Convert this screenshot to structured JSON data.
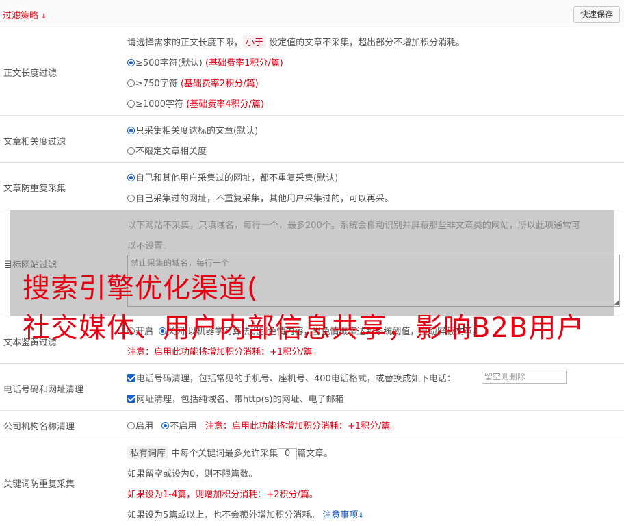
{
  "header": {
    "title": "过滤策略",
    "chevron_icon": "chevron-double-down-icon",
    "save_label": "快速保存"
  },
  "length_filter": {
    "label": "正文长度过滤",
    "desc_pre": "请选择需求的正文长度下限，",
    "desc_tag": "小于",
    "desc_post": "设定值的文章不采集，超出部分不增加积分消耗。",
    "options": [
      {
        "text": "≥500字符(默认)",
        "note": "(基础费率1积分/篇)",
        "selected": true
      },
      {
        "text": "≥750字符",
        "note": "(基础费率2积分/篇)",
        "selected": false
      },
      {
        "text": "≥1000字符",
        "note": "(基础费率4积分/篇)",
        "selected": false
      }
    ]
  },
  "relevance_filter": {
    "label": "文章相关度过滤",
    "options": [
      {
        "text": "只采集相关度达标的文章(默认)",
        "selected": true
      },
      {
        "text": "不限定文章相关度",
        "selected": false
      }
    ]
  },
  "duplicate_filter": {
    "label": "文章防重复采集",
    "options": [
      {
        "text": "自己和其他用户采集过的网址，都不重复采集(默认)",
        "selected": true
      },
      {
        "text": "自己采集过的网址，不重复采集，其他用户采集过的，可以再采。",
        "selected": false
      }
    ]
  },
  "site_filter": {
    "label": "目标网站过滤",
    "desc_line1": "以下网站不采集，只填域名，每行一个，最多200个。系统会自动识别并屏蔽那些非文章类的网站，所以此项通常可",
    "desc_line2": "以不设置。",
    "placeholder": "禁止采集的域名，每行一个"
  },
  "porn_filter": {
    "label": "文本鉴黄过滤",
    "on_label": "开启",
    "off_label": "关闭",
    "desc": "以机器学习算法识别色情内容，当色情概率达到系统阈值，自动屏蔽文章。",
    "note": "注意：启用此功能将增加积分消耗：+1积分/篇。"
  },
  "contact_filter": {
    "label": "电话号码和网址清理",
    "phone_text": "电话号码清理，包括常见的手机号、座机号、400电话格式，或替换成如下电话：",
    "phone_placeholder": "留空则删除",
    "url_text": "网址清理，包括纯域名、带http(s)的网址、电子邮箱"
  },
  "company_filter": {
    "label": "公司机构名称清理",
    "on_label": "启用",
    "off_label": "不启用",
    "note": "注意：启用此功能将增加积分消耗：+1积分/篇。"
  },
  "keyword_filter": {
    "label": "关键词防重复采集",
    "tag": "私有词库",
    "desc_pre": "中每个关键词最多允许采集",
    "value": "0",
    "desc_post": "篇文章。",
    "line2": "如果留空或设为0，则不限篇数。",
    "line3": "如果设为1-4篇，则增加积分消耗：+2积分/篇。",
    "line4": "如果设为5篇或以上，也不会额外增加积分消耗。",
    "notice_link": "注意事项",
    "notice_icon": "chevron-double-down-icon"
  },
  "watermark": {
    "line1": "搜索引擎优化渠道(",
    "line2": "社交媒体、用户内部信息共享，影响B2B用户"
  }
}
